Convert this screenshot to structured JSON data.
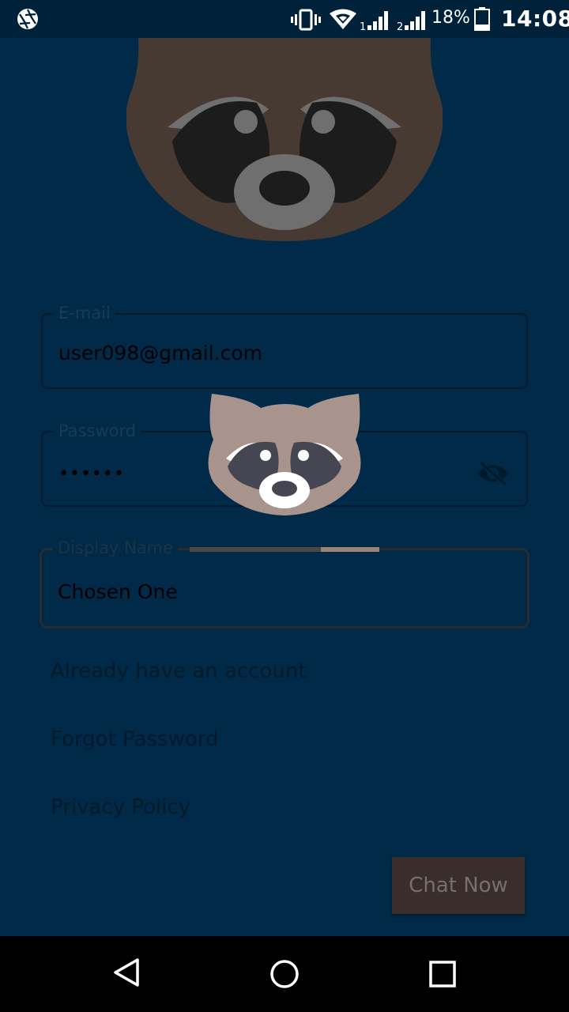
{
  "status_bar": {
    "battery": "18%",
    "time": "14:08",
    "sim1": "1",
    "sim2": "2",
    "icons": [
      "aperture-icon",
      "vibrate-icon",
      "wifi-icon",
      "signal-icon",
      "signal-icon",
      "battery-icon"
    ]
  },
  "form": {
    "email_label": "E-mail",
    "email_value": "user098@gmail.com",
    "password_label": "Password",
    "password_value": "••••••",
    "display_label": "Display Name",
    "display_value": "Chosen One"
  },
  "links": {
    "account": "Already have an account",
    "forgot": "Forgot Password",
    "privacy": "Privacy Policy"
  },
  "chat_button": "Chat Now",
  "loading_progress": 0.31,
  "colors": {
    "background": "#002a47",
    "button": "#3a2e2c",
    "raccoon": "#463a33"
  }
}
